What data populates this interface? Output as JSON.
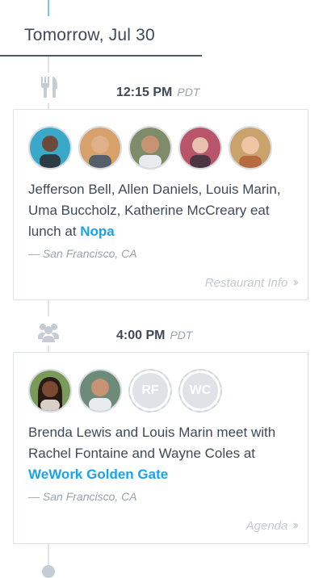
{
  "day_header": {
    "label": "Tomorrow,  Jul 30"
  },
  "events": [
    {
      "time": "12:15 PM",
      "timezone": "PDT",
      "icon": "cutlery-icon",
      "attendees": [
        {
          "name": "Jefferson Bell",
          "bg": "#3aa8c9",
          "skin": "#6b4a3a"
        },
        {
          "name": "Allen Daniels",
          "bg": "#d6a16a",
          "skin": "#e0b08a"
        },
        {
          "name": "Louis Marin",
          "bg": "#7e8c6a",
          "skin": "#c89372"
        },
        {
          "name": "Uma Buccholz",
          "bg": "#b8556a",
          "skin": "#e8c2ae"
        },
        {
          "name": "Katherine McCreary",
          "bg": "#c9a36c",
          "skin": "#f0c5a5"
        }
      ],
      "desc": {
        "n1": "Jefferson Bell",
        "sep1": ", ",
        "n2": "Allen Daniels",
        "sep2": ", ",
        "n3": "Louis Marin",
        "sep3": ", ",
        "n4": "Uma Buccholz",
        "sep4": ", ",
        "n5": "Katherine McCreary",
        "verb": " eat lunch at ",
        "place": "Nopa"
      },
      "location": "— San Francisco, CA",
      "action": "Restaurant Info"
    },
    {
      "time": "4:00 PM",
      "timezone": "PDT",
      "icon": "group-icon",
      "attendees": [
        {
          "name": "Brenda Lewis",
          "bg": "#7a9a5a",
          "skin": "#7a4a32"
        },
        {
          "name": "Louis Marin",
          "bg": "#6e8a78",
          "skin": "#c89372"
        }
      ],
      "invitees": [
        {
          "initials": "RF"
        },
        {
          "initials": "WC"
        }
      ],
      "desc": {
        "n1": "Brenda Lewis",
        "conj1": " and ",
        "n2": "Louis Marin",
        "verb": " meet with ",
        "n3": "Rachel Fontaine",
        "conj2": " and ",
        "n4": "Wayne Coles",
        "at": " at ",
        "place": "WeWork Golden Gate"
      },
      "location": "— San Francisco, CA",
      "action": "Agenda"
    }
  ],
  "colors": {
    "accent": "#1aa3e8",
    "text": "#3e4a57",
    "muted": "#9aa4ad"
  }
}
